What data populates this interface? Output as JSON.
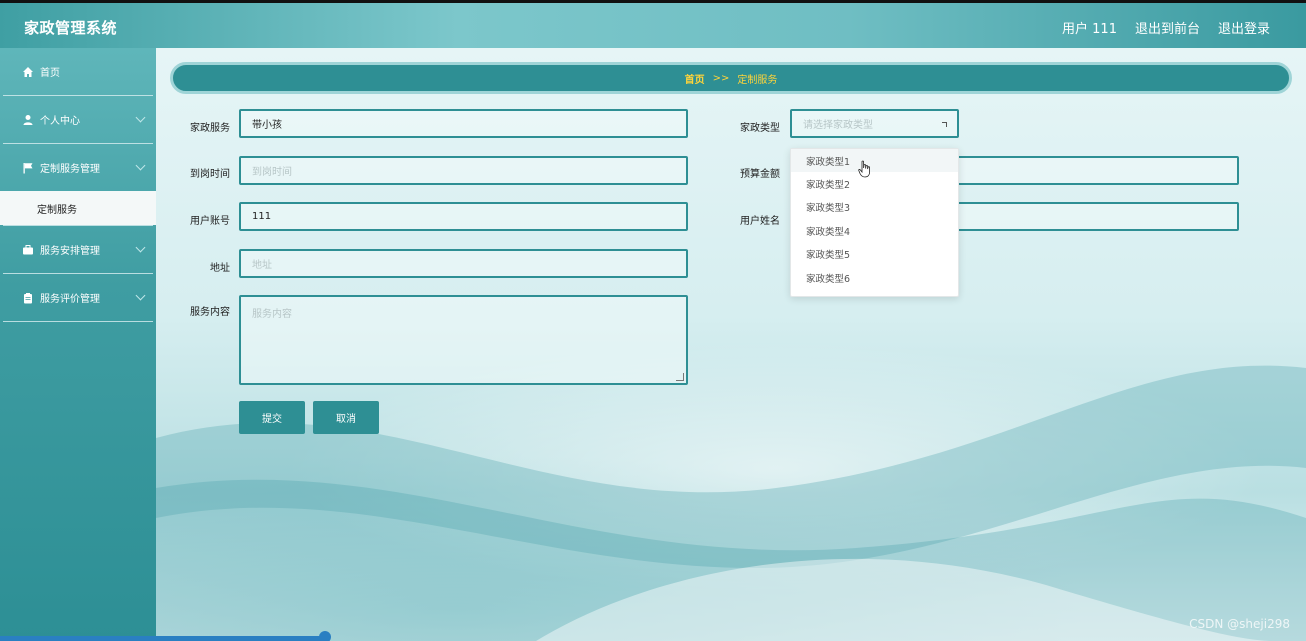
{
  "app": {
    "title": "家政管理系统"
  },
  "header": {
    "user_label": "用户 111",
    "back_to_front": "退出到前台",
    "logout": "退出登录"
  },
  "sidebar": {
    "items": [
      {
        "label": "首页",
        "icon": "home-icon"
      },
      {
        "label": "个人中心",
        "icon": "user-icon"
      },
      {
        "label": "定制服务管理",
        "icon": "flag-icon"
      },
      {
        "label": "服务安排管理",
        "icon": "briefcase-icon"
      },
      {
        "label": "服务评价管理",
        "icon": "clipboard-icon"
      }
    ],
    "submenu_active": "定制服务"
  },
  "breadcrumb": {
    "home": "首页",
    "separator": ">>",
    "current": "定制服务"
  },
  "form": {
    "service": {
      "label": "家政服务",
      "value": "带小孩"
    },
    "arrival_time": {
      "label": "到岗时间",
      "placeholder": "到岗时间"
    },
    "account": {
      "label": "用户账号",
      "value": "111"
    },
    "address": {
      "label": "地址",
      "placeholder": "地址"
    },
    "content": {
      "label": "服务内容",
      "placeholder": "服务内容"
    },
    "type": {
      "label": "家政类型",
      "placeholder": "请选择家政类型"
    },
    "budget": {
      "label": "预算金额"
    },
    "username": {
      "label": "用户姓名"
    },
    "type_options": [
      "家政类型1",
      "家政类型2",
      "家政类型3",
      "家政类型4",
      "家政类型5",
      "家政类型6"
    ],
    "submit": "提交",
    "cancel": "取消"
  },
  "colors": {
    "primary": "#2e8f94",
    "breadcrumb_text": "#ffd43a"
  },
  "watermark": "CSDN @sheji298"
}
